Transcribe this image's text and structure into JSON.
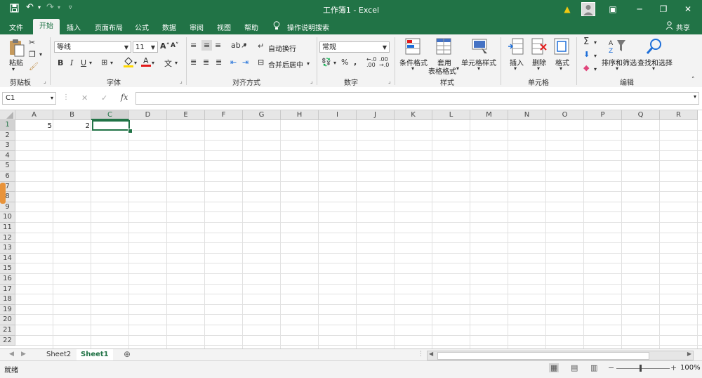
{
  "titlebar": {
    "title": "工作簿1  -  Excel",
    "save_icon": "save-icon",
    "undo_icon": "undo-icon",
    "redo_icon": "redo-icon",
    "customize_icon": "customize-icon",
    "window_controls": [
      "ribbon-display-icon",
      "minimize-icon",
      "restore-icon",
      "close-icon"
    ]
  },
  "tabs": [
    "文件",
    "开始",
    "插入",
    "页面布局",
    "公式",
    "数据",
    "审阅",
    "视图",
    "帮助"
  ],
  "tell_me": "操作说明搜索",
  "share": "共享",
  "ribbon": {
    "clipboard": {
      "paste": "粘贴",
      "group": "剪贴板"
    },
    "font": {
      "name": "等线",
      "size": "11",
      "group": "字体",
      "bold": "B",
      "italic": "I",
      "underline": "U"
    },
    "alignment": {
      "wrap": "自动换行",
      "merge": "合并后居中",
      "group": "对齐方式"
    },
    "number": {
      "format": "常规",
      "group": "数字"
    },
    "styles": {
      "conditional": "条件格式",
      "table_line1": "套用",
      "table_line2": "表格格式",
      "cell_styles": "单元格样式",
      "group": "样式"
    },
    "cells": {
      "insert": "插入",
      "delete": "删除",
      "format": "格式",
      "group": "单元格"
    },
    "editing": {
      "sort": "排序和筛选",
      "find": "查找和选择",
      "group": "编辑"
    }
  },
  "formula_bar": {
    "name_box": "C1",
    "cancel": "✕",
    "enter": "✓",
    "fx": "fx",
    "formula": ""
  },
  "columns": [
    "A",
    "B",
    "C",
    "D",
    "E",
    "F",
    "G",
    "H",
    "I",
    "J",
    "K",
    "L",
    "M",
    "N",
    "O",
    "P",
    "Q",
    "R"
  ],
  "rows": [
    "1",
    "2",
    "3",
    "4",
    "5",
    "6",
    "7",
    "8",
    "9",
    "10",
    "11",
    "12",
    "13",
    "14",
    "15",
    "16",
    "17",
    "18",
    "19",
    "20",
    "21",
    "22"
  ],
  "cells": {
    "A1": "5",
    "B1": "2"
  },
  "sheets": [
    "Sheet2",
    "Sheet1"
  ],
  "active_sheet": "Sheet1",
  "status": {
    "ready": "就绪",
    "zoom": "100%"
  },
  "colors": {
    "brand": "#217346",
    "ribbon_bg": "#f3f3f3",
    "grid_line": "#e1e1e1"
  }
}
